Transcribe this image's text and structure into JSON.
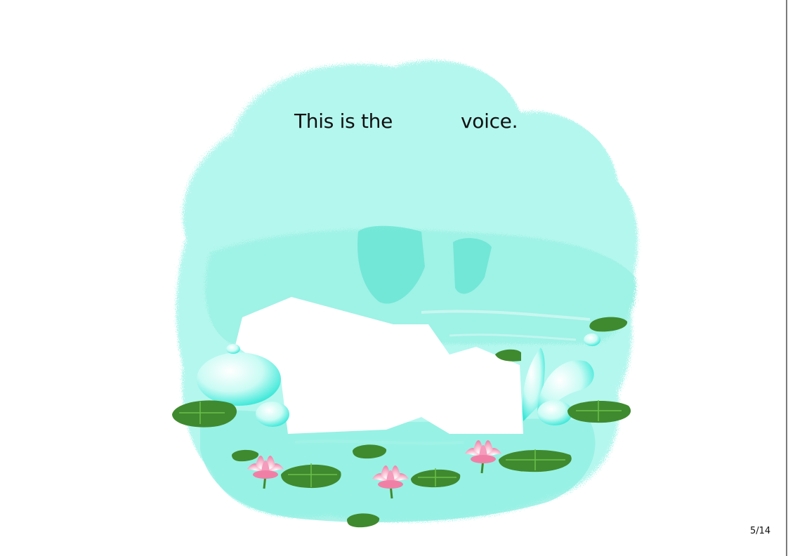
{
  "caption": {
    "before_blank": "This is the",
    "after_blank": "voice."
  },
  "page_number": "5/14",
  "illustration": {
    "subject": "pond with water lilies",
    "colors": {
      "water": "#aef4ea",
      "water_deep": "#7eead9",
      "lily_pad": "#3f8a2e",
      "lily_pad_light": "#5aa83c",
      "lotus_petal": "#f07fa6",
      "lotus_center": "#ffd84a"
    }
  }
}
